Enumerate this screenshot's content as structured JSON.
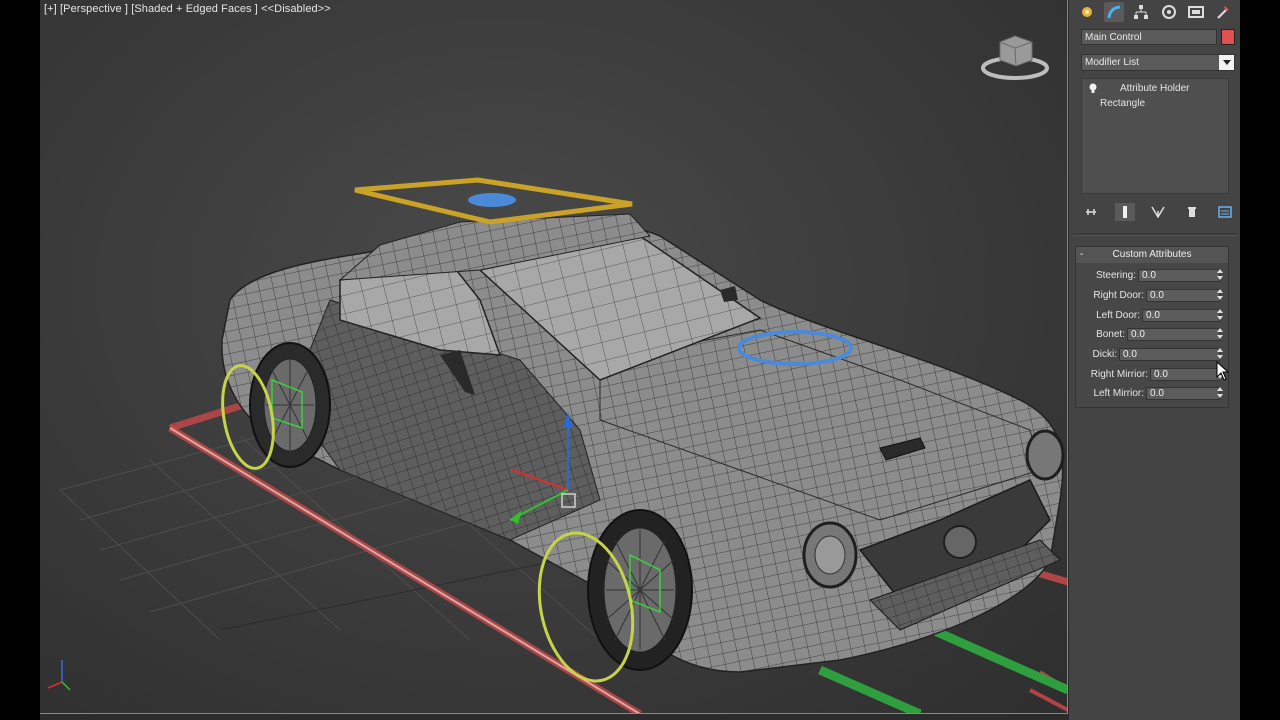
{
  "viewport": {
    "label": {
      "plus": "[+]",
      "view": "[Perspective ]",
      "shading": "[Shaded + Edged Faces ]",
      "disabled": "<<Disabled>>"
    }
  },
  "command_panel": {
    "tabs": [
      {
        "name": "create-tab-icon"
      },
      {
        "name": "modify-tab-icon"
      },
      {
        "name": "hierarchy-tab-icon"
      },
      {
        "name": "motion-tab-icon"
      },
      {
        "name": "display-tab-icon"
      },
      {
        "name": "utilities-tab-icon"
      }
    ],
    "object_name": "Main Control",
    "object_color": "#e05050",
    "modifier_list": "Modifier List",
    "stack": {
      "top": "Attribute Holder",
      "base": "Rectangle"
    },
    "custom_attributes": {
      "title": "Custom Attributes",
      "collapse": "-",
      "rows": [
        {
          "label": "Steering:",
          "value": "0.0"
        },
        {
          "label": "Right Door:",
          "value": "0.0"
        },
        {
          "label": "Left Door:",
          "value": "0.0"
        },
        {
          "label": "Bonet:",
          "value": "0.0"
        },
        {
          "label": "Dicki:",
          "value": "0.0"
        },
        {
          "label": "Right Mirrior:",
          "value": "0.0"
        },
        {
          "label": "Left Mirrior:",
          "value": "0.0"
        }
      ]
    }
  },
  "colors": {
    "selection_border": "#a88a2a",
    "wire_control": "#c7d44a",
    "roof_control": "#c9a227",
    "blue_control": "#4a8ad8",
    "path_red": "#d04a4a",
    "path_green": "#2e9e3e"
  }
}
